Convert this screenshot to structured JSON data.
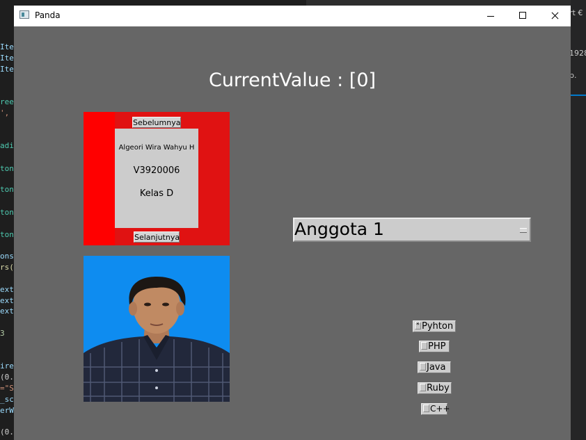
{
  "editor": {
    "left_code": [
      "Ite",
      "Ite",
      "Ite",
      "ree",
      "',",
      "adi",
      "ton",
      "ton",
      "ton",
      "ton",
      "ons",
      "rs(",
      "ext",
      "ext",
      "ext",
      "3",
      "ire",
      "(0.",
      "=\"S",
      "_sc",
      "erW",
      "(0."
    ],
    "right_text": [
      "rt  €",
      "1928",
      "b."
    ]
  },
  "window": {
    "title": "Panda",
    "current_value_label": "CurrentValue : [0]",
    "card": {
      "prev_label": "Sebelumnya",
      "next_label": "Selanjutnya",
      "name": "Algeori Wira Wahyu H",
      "nim": "V3920006",
      "class": "Kelas D"
    },
    "dropdown": {
      "selected": "Anggota 1"
    },
    "radios": [
      {
        "label": "Pyhton",
        "checked": true
      },
      {
        "label": "PHP",
        "checked": false
      },
      {
        "label": "Java",
        "checked": false
      },
      {
        "label": "Ruby",
        "checked": false
      },
      {
        "label": "C++",
        "checked": false
      }
    ]
  },
  "colors": {
    "window_bg": "#666666",
    "card_red": "#e01212",
    "photo_blue": "#0e8cf0"
  }
}
